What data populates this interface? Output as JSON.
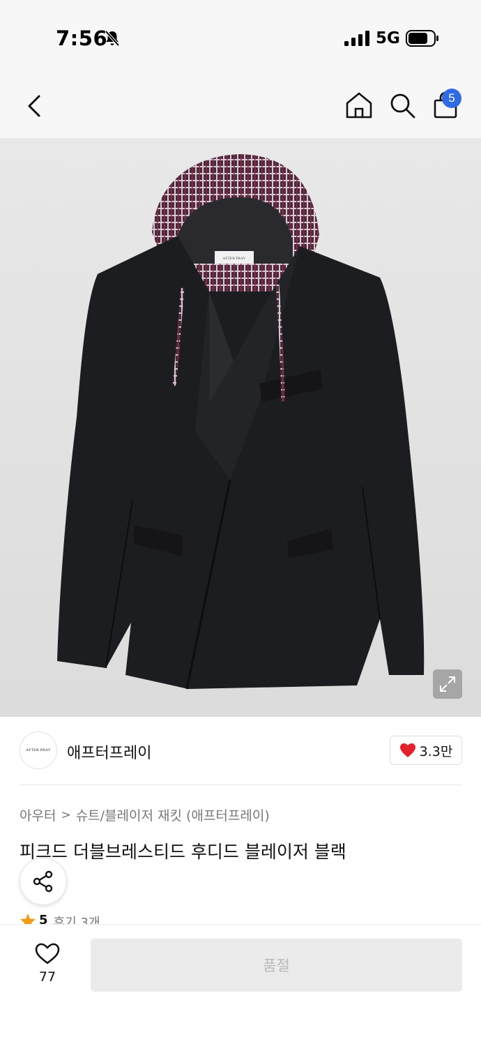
{
  "status_bar": {
    "time": "7:56",
    "network": "5G"
  },
  "header": {
    "cart_count": "5"
  },
  "product_image": {
    "label_text": "AFTER PRAY"
  },
  "store": {
    "logo_text": "AFTER PRAY",
    "name": "애프터프레이",
    "like_count": "3.3만"
  },
  "breadcrumb": {
    "category": "아우터",
    "separator": ">",
    "subcategory": "슈트/블레이저 재킷 (애프터프레이)"
  },
  "product": {
    "title": "피크드 더블브레스티드 후디드 블레이저 블랙"
  },
  "rating": {
    "score": "5",
    "reviews": "후기 3개"
  },
  "bottom_bar": {
    "wish_count": "77",
    "soldout_label": "품절"
  },
  "colors": {
    "badge_blue": "#2f6be5",
    "heart_red": "#e4202b",
    "star_orange": "#f49b14",
    "jacket_black": "#1c1d20"
  },
  "icons": [
    "bell-off-icon",
    "signal-icon",
    "battery-icon",
    "back-icon",
    "home-icon",
    "search-icon",
    "cart-icon",
    "expand-icon",
    "heart-icon",
    "share-icon",
    "star-icon"
  ]
}
